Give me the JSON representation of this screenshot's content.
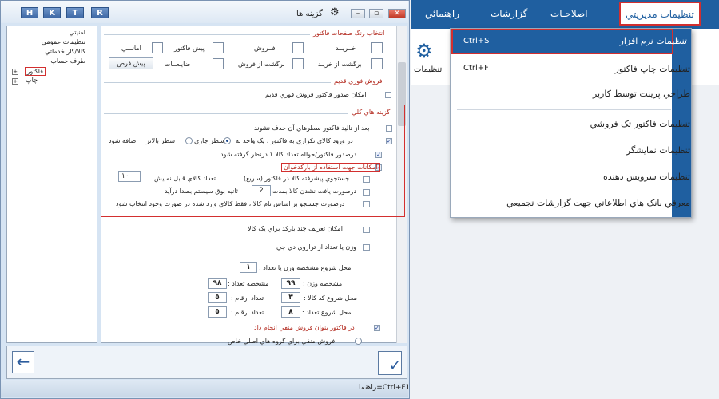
{
  "dialog": {
    "title": "گزينه ها",
    "hotkeys": [
      "H",
      "K",
      "T",
      "R"
    ],
    "status": "راهنما=Ctrl+F1"
  },
  "tree": {
    "items": [
      "امنيتي",
      "تنظيمات عمومي",
      "کالا/کار خدماتي",
      "طرف حساب",
      "فاکتور",
      "چاپ"
    ]
  },
  "colors": {
    "section_title": "انتخاب رنگ صفحات فاکتور",
    "buttons": [
      "خــريــد",
      "فــروش",
      "پيش فاکتور",
      "امانـــي",
      "برگشت از خريـد",
      "برگشت از فروش",
      "ضايـعــات"
    ],
    "default": "پيش فرض"
  },
  "quick": {
    "title": "فروش فوري قديم",
    "opt": "امکان صدور فاکتور فروش فوري قديم"
  },
  "general": {
    "title": "گزينه هاي کلي",
    "o1": "بعد از تاليد فاکتور سطرهاي آن حذف نشوند",
    "o2": "در ورود کالاي تکراري به فاکتور ، يک واحد به",
    "r1": "سطر جاري",
    "r2": "سطر بالاتر",
    "o2b": "اضافه شود",
    "o3": "درصدور فاکتور/حواله تعداد کالا ١ درنظر گرفته شود",
    "o4": "امکانات جهت استفاده از بارکدخوان",
    "o5": "جستجوي پيشرفته کالا در فاکتور (سريع)",
    "o5b": "تعداد کالاي قابل نمايش",
    "v5": "١٠",
    "o6": "درصورت يافت نشدن کالا بمدت",
    "v6": "2",
    "o6b": "ثانيه بوق سيستم بصدا درآيد",
    "o7": "درصورت جستجو بر اساس نام کالا ، فقط کالاي وارد شده در صورت وجود انتخاب شود"
  },
  "barcode": {
    "o1": "امکان تعريف چند بارکد براي يک کالا",
    "o2": "وزن يا تعداد از ترازوي دي جي",
    "l1": "محل شروع مشخصه وزن يا تعداد :",
    "v1": "١",
    "l2": "مشخصه وزن :",
    "v2": "٩٩",
    "l3": "مشخصه تعداد :",
    "v3": "٩٨",
    "l4": "محل شروع کد کالا :",
    "v4": "٣",
    "l5": "تعداد ارقام :",
    "v5": "٥",
    "l6": "محل شروع تعداد :",
    "v6": "٨",
    "l7": "تعداد ارقام :",
    "v7": "٥",
    "neg": "در فاکتور بنوان فروش منفي انجام داد",
    "negsub": "فروش منفي براي گروه هاي اصلي خاص"
  },
  "menu": {
    "items": [
      "تنظيمات مديريتي",
      "اصلاحـات",
      "گزارشات",
      "راهنمائي"
    ],
    "ribbon": "تنظيمات"
  },
  "dropdown": {
    "items": [
      {
        "label": "تنظيمات نرم افزار",
        "shortcut": "Ctrl+S"
      },
      {
        "label": "تنظيمات چاپ فاکتور",
        "shortcut": "Ctrl+F"
      },
      {
        "label": "طراحي پرينت توسط کاربر",
        "shortcut": ""
      },
      {
        "label": "تنظيمات فاکتور تک فروشي",
        "shortcut": ""
      },
      {
        "label": "تنظيمات نمايشگر",
        "shortcut": ""
      },
      {
        "label": "تنظيمات سرويس دهنده",
        "shortcut": ""
      },
      {
        "label": "معرفي بانک هاي اطلاعاتي جهت گزارشات تجميعي",
        "shortcut": ""
      }
    ]
  }
}
